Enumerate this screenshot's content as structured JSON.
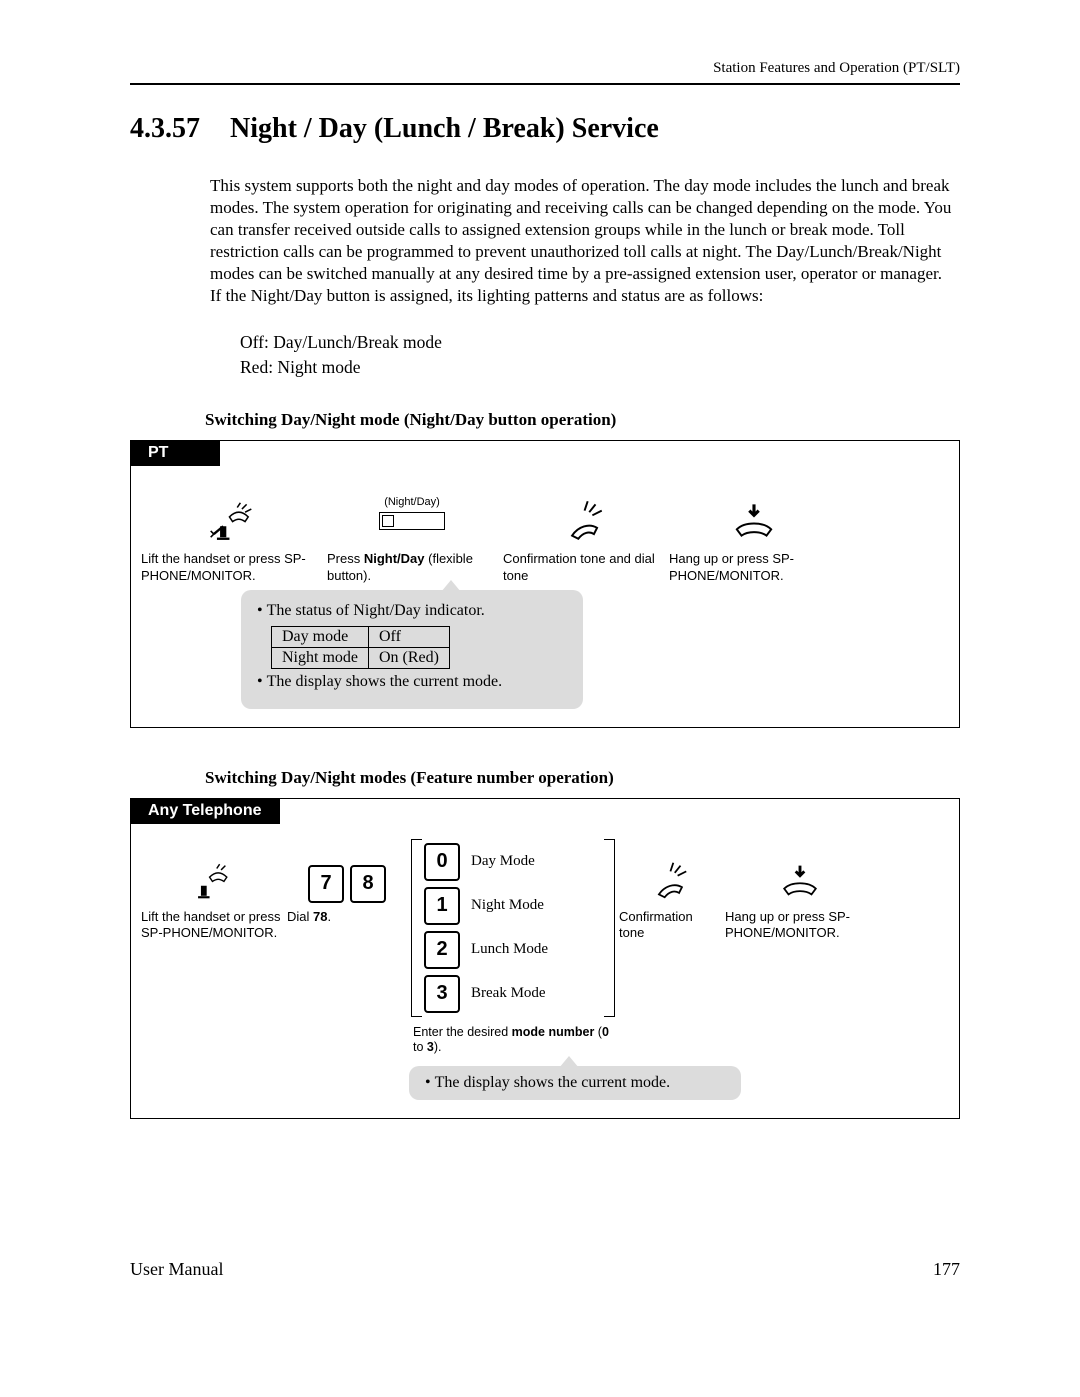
{
  "header_right": "Station Features and Operation (PT/SLT)",
  "section_number": "4.3.57",
  "section_title": "Night / Day (Lunch / Break) Service",
  "paragraph": "This system supports both the night and day modes of operation. The day mode includes the lunch and break modes. The system operation for originating and receiving calls can be changed depending on the mode. You can transfer received outside calls to assigned extension groups while in the lunch or break mode. Toll restriction calls can be programmed to prevent unauthorized toll calls at night. The Day/Lunch/Break/Night modes can be switched manually at any desired time by a pre-assigned extension user, operator or manager.\nIf the Night/Day button is assigned, its lighting patterns and status are as follows:",
  "light_off": "Off: Day/Lunch/Break mode",
  "light_red": "Red: Night mode",
  "sub1": "Switching Day/Night mode (Night/Day button operation)",
  "pt": {
    "tab": "PT",
    "step1": "Lift the handset or press SP-PHONE/MONITOR.",
    "btn_label": "(Night/Day)",
    "step2_a": "Press ",
    "step2_b": "Night/Day",
    "step2_c": " (flexible button).",
    "step3": "Confirmation tone and dial tone",
    "step4": "Hang up or press SP-PHONE/MONITOR.",
    "callout_line1": "The status of Night/Day indicator.",
    "ind": {
      "r1c1": "Day mode",
      "r1c2": "Off",
      "r2c1": "Night mode",
      "r2c2": "On (Red)"
    },
    "callout_line2": "The display shows the current mode."
  },
  "sub2": "Switching Day/Night modes (Feature number operation)",
  "any": {
    "tab": "Any Telephone",
    "step1": "Lift the handset or press SP-PHONE/MONITOR.",
    "dial_a": "Dial ",
    "dial_b": "78",
    "dial_c": ".",
    "keys": [
      "7",
      "8"
    ],
    "modes": [
      {
        "k": "0",
        "label": "Day Mode"
      },
      {
        "k": "1",
        "label": "Night Mode"
      },
      {
        "k": "2",
        "label": "Lunch Mode"
      },
      {
        "k": "3",
        "label": "Break Mode"
      }
    ],
    "enter_a": "Enter the desired ",
    "enter_b": "mode number",
    "enter_c": " (",
    "enter_d": "0",
    "enter_e": " to ",
    "enter_f": "3",
    "enter_g": ").",
    "step3": "Confirmation tone",
    "step4": "Hang up or press SP-PHONE/MONITOR.",
    "callout": "The display shows the current mode."
  },
  "footer_left": "User Manual",
  "footer_right": "177"
}
